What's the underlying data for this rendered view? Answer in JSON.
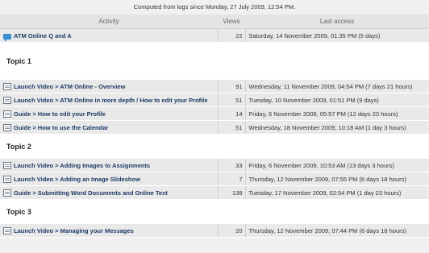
{
  "caption": "Computed from logs since Monday, 27 July 2009, 12:54 PM.",
  "columns": {
    "activity": "Activity",
    "views": "Views",
    "last_access": "Last access"
  },
  "top_item": {
    "activity": "ATM Online Q and A",
    "icon": "forum-icon",
    "views": "22",
    "last_access": "Saturday, 14 November 2009, 01:35 PM (5 days)"
  },
  "sections": [
    {
      "title": "Topic 1",
      "rows": [
        {
          "activity": "Launch Video > ATM Online - Overview",
          "views": "91",
          "last_access": "Wednesday, 11 November 2009, 04:54 PM (7 days 21 hours)"
        },
        {
          "activity": "Launch Video > ATM Online in more depth / How to edit your Profile",
          "views": "51",
          "last_access": "Tuesday, 10 November 2009, 01:51 PM (9 days)"
        },
        {
          "activity": "Guide > How to edit your Profile",
          "views": "14",
          "last_access": "Friday, 6 November 2009, 05:57 PM (12 days 20 hours)"
        },
        {
          "activity": "Guide > How to use the Calendar",
          "views": "51",
          "last_access": "Wednesday, 18 November 2009, 10:18 AM (1 day 3 hours)"
        }
      ]
    },
    {
      "title": "Topic 2",
      "rows": [
        {
          "activity": "Launch Video > Adding Images to Assignments",
          "views": "33",
          "last_access": "Friday, 6 November 2009, 10:53 AM (13 days 3 hours)"
        },
        {
          "activity": "Launch Video > Adding an Image Slideshow",
          "views": "7",
          "last_access": "Thursday, 12 November 2009, 07:55 PM (6 days 18 hours)"
        },
        {
          "activity": "Guide > Submitting Word Documents and Online Text",
          "views": "138",
          "last_access": "Tuesday, 17 November 2009, 02:54 PM (1 day 23 hours)"
        }
      ]
    },
    {
      "title": "Topic 3",
      "rows": [
        {
          "activity": "Launch Video > Managing your Messages",
          "views": "20",
          "last_access": "Thursday, 12 November 2009, 07:44 PM (6 days 18 hours)"
        }
      ]
    }
  ]
}
